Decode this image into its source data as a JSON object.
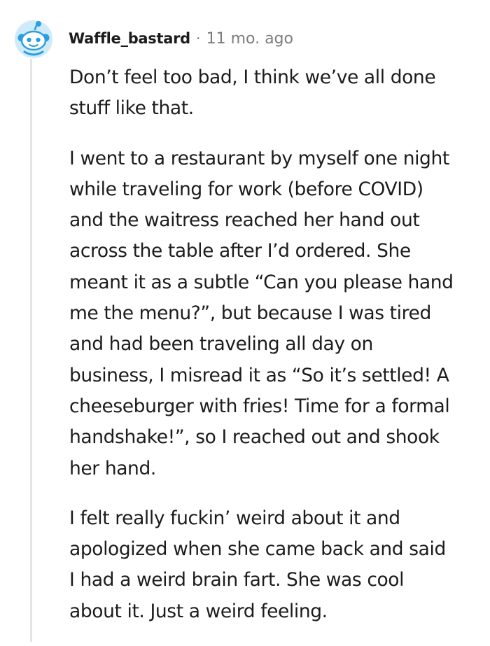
{
  "comment": {
    "author": "Waffle_bastard",
    "separator": "·",
    "timestamp": "11 mo. ago",
    "paragraphs": [
      {
        "lines": [
          "Don’t feel too bad, I think we’ve all done",
          "stuff like that."
        ]
      },
      {
        "lines": [
          "I went to a restaurant by myself one night",
          "while traveling for work (before COVID)",
          "and the waitress reached her hand out",
          "across the table after I’d ordered. She",
          "meant it as a subtle “Can you please hand",
          "me the menu?”, but because I was tired",
          "and had been traveling all day on",
          "business, I misread it as “So it’s settled! A",
          "cheeseburger with fries! Time for a formal",
          "handshake!”, so I reached out and shook",
          "her hand."
        ]
      },
      {
        "lines": [
          "I felt really fuckin’ weird about it and",
          "apologized when she came back and said",
          "I had a weird brain fart. She was cool",
          "about it. Just a weird feeling."
        ]
      }
    ]
  },
  "icons": {
    "avatar": "snoo-avatar-icon"
  },
  "colors": {
    "avatar_blue": "#2b9fde",
    "avatar_light": "#c7e8f7",
    "thread_line": "#e5e5e5",
    "meta_gray": "#7c7c7c",
    "text": "#1c1c1c"
  }
}
